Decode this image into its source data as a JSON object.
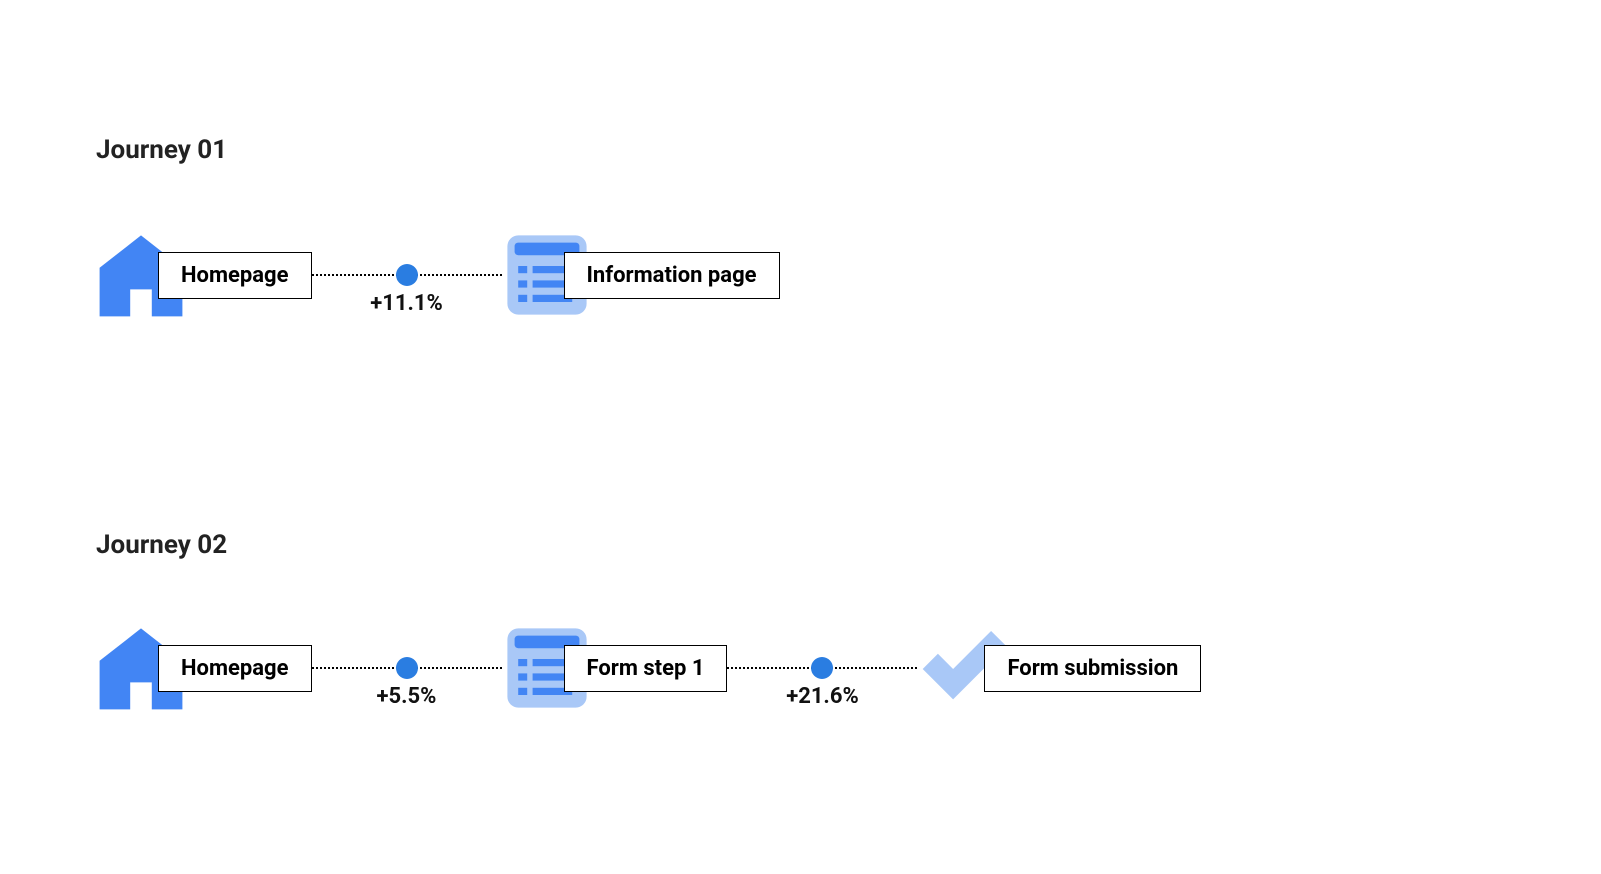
{
  "colors": {
    "primary_blue": "#4285f4",
    "light_blue": "#a9c8f7",
    "dot_blue": "#2a7de1"
  },
  "journeys": [
    {
      "title": "Journey 01",
      "steps": [
        {
          "icon": "home",
          "label": "Homepage"
        },
        {
          "icon": "list",
          "label": "Information page"
        }
      ],
      "connectors": [
        {
          "metric": "+11.1%"
        }
      ]
    },
    {
      "title": "Journey 02",
      "steps": [
        {
          "icon": "home",
          "label": "Homepage"
        },
        {
          "icon": "list",
          "label": "Form step 1"
        },
        {
          "icon": "check",
          "label": "Form submission"
        }
      ],
      "connectors": [
        {
          "metric": "+5.5%"
        },
        {
          "metric": "+21.6%"
        }
      ]
    }
  ]
}
